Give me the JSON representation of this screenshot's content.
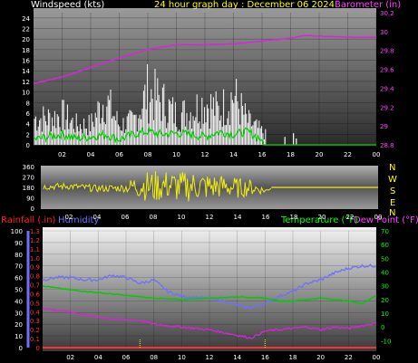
{
  "colors": {
    "wind": "#ffffff",
    "gust": "#ffffff",
    "wind_avg": "#00d000",
    "barometer": "#e020e0",
    "direction": "#f2ef10",
    "rainfall_label": "#ff2020",
    "rainfall_axis": "#ff3030",
    "humidity": "#6f6fff",
    "temperature": "#00cc00",
    "dewpoint": "#dd20dd",
    "text_white": "#ffffff",
    "date_header": "#ffff00",
    "baro_axis": "#ff40ff",
    "temp_axis": "#00ff00",
    "dir_axis": "#ffff00"
  },
  "header": {
    "wind_label": "Windspeed (kts)",
    "date_label": "24 hour graph day : December 06 2024",
    "baro_label": "Barometer (in)"
  },
  "middle": {
    "compass_letters": [
      "N",
      "W",
      "S",
      "E",
      "N"
    ]
  },
  "bottom_header": {
    "rain_label": "Rainfall (.in)",
    "humidity_label": "Humidity",
    "temp_label": "Temperature (°F)",
    "dew_label": "Dew Point (°F)"
  },
  "chart_data": [
    {
      "type": "line",
      "title": "24 hour graph day : December 06 2024",
      "x_ticks": [
        "02",
        "04",
        "06",
        "08",
        "10",
        "12",
        "14",
        "16",
        "18",
        "20",
        "22",
        "00"
      ],
      "xlim": [
        0,
        24
      ],
      "left_axis": {
        "label": "Windspeed (kts)",
        "ylim": [
          0,
          25
        ],
        "ticks": [
          "0",
          "2",
          "4",
          "6",
          "8",
          "10",
          "12",
          "14",
          "16",
          "18",
          "20",
          "22",
          "24"
        ]
      },
      "right_axis": {
        "label": "Barometer (in)",
        "ylim": [
          28.8,
          30.2
        ],
        "ticks": [
          "28.8",
          "29",
          "29.2",
          "29.4",
          "29.6",
          "29.8",
          "30",
          "30.2"
        ]
      },
      "series": [
        {
          "name": "Barometer (in)",
          "axis": "right",
          "x": [
            0,
            2,
            4,
            6,
            8,
            10,
            12,
            14,
            16,
            18,
            19,
            20,
            22,
            24
          ],
          "y": [
            29.45,
            29.52,
            29.62,
            29.72,
            29.81,
            29.86,
            29.86,
            29.87,
            29.9,
            29.93,
            29.96,
            29.95,
            29.94,
            29.94
          ]
        },
        {
          "name": "Wind average (kts)",
          "axis": "left",
          "x": [
            0,
            1,
            2,
            3,
            4,
            5,
            6,
            7,
            8,
            9,
            10,
            11,
            12,
            13,
            14,
            15,
            16,
            16.1,
            24
          ],
          "y": [
            1.0,
            1.5,
            2.0,
            1.2,
            1.5,
            2.0,
            1.0,
            2.0,
            2.5,
            2.0,
            2.2,
            2.0,
            1.5,
            2.5,
            2.0,
            2.5,
            1.0,
            0,
            0
          ]
        },
        {
          "name": "Wind gust (kts)",
          "axis": "left",
          "x": [
            0,
            1,
            2,
            3,
            4,
            5,
            6,
            7,
            8,
            9,
            10,
            11,
            12,
            13,
            14,
            15,
            16,
            17,
            18,
            19,
            20,
            21,
            22,
            23,
            24
          ],
          "y": [
            8,
            8,
            9,
            6,
            6,
            14,
            6,
            7,
            16,
            13,
            9,
            10,
            13,
            10,
            15,
            7,
            4,
            0,
            2,
            0,
            0,
            0,
            0,
            0,
            0
          ]
        }
      ]
    },
    {
      "type": "line",
      "x_ticks": [
        "02",
        "04",
        "06",
        "08",
        "10",
        "12",
        "14",
        "16",
        "18",
        "20",
        "22",
        "00"
      ],
      "xlim": [
        0,
        24
      ],
      "left_axis": {
        "ylim": [
          0,
          360
        ],
        "ticks": [
          "0",
          "90",
          "180",
          "270",
          "360"
        ]
      },
      "series": [
        {
          "name": "Wind direction (deg)",
          "x": [
            0,
            2,
            4,
            6,
            7,
            8,
            9,
            10,
            11,
            12,
            13,
            14,
            15,
            16,
            16.5,
            24
          ],
          "y": [
            185,
            190,
            170,
            175,
            200,
            185,
            200,
            180,
            195,
            185,
            190,
            175,
            180,
            150,
            180,
            180
          ],
          "band": [
            25,
            30,
            30,
            35,
            120,
            140,
            130,
            140,
            130,
            120,
            100,
            90,
            70,
            20,
            0,
            0
          ]
        }
      ]
    },
    {
      "type": "line",
      "x_ticks": [
        "02",
        "04",
        "06",
        "08",
        "10",
        "12",
        "14",
        "16",
        "18",
        "20",
        "22",
        "00"
      ],
      "xlim": [
        0,
        24
      ],
      "left_axis_humidity": {
        "label": "Humidity",
        "ylim": [
          0,
          100
        ],
        "ticks": [
          "0",
          "10",
          "20",
          "30",
          "40",
          "50",
          "60",
          "70",
          "80",
          "90",
          "100"
        ]
      },
      "left_axis_rain": {
        "label": "Rainfall (.in)",
        "ylim": [
          0,
          1.3
        ],
        "ticks": [
          "0",
          "0.1",
          "0.2",
          "0.3",
          "0.4",
          "0.5",
          "0.6",
          "0.7",
          "0.8",
          "0.9",
          "1.0",
          "1.1",
          "1.2",
          "1.3"
        ]
      },
      "right_axis": {
        "label": "Temperature (°F)",
        "ylim": [
          -15,
          70
        ],
        "ticks": [
          "-10",
          "0",
          "10",
          "20",
          "30",
          "40",
          "50",
          "60",
          "70"
        ]
      },
      "series": [
        {
          "name": "Humidity",
          "axis": "humidity",
          "x": [
            0,
            1,
            2,
            3,
            4,
            5,
            6,
            7,
            8,
            9,
            10,
            11,
            12,
            13,
            14,
            15,
            16,
            17,
            18,
            19,
            20,
            21,
            22,
            23,
            24
          ],
          "y": [
            58,
            60,
            60,
            58,
            58,
            62,
            60,
            55,
            58,
            48,
            44,
            43,
            42,
            40,
            36,
            34,
            38,
            44,
            48,
            55,
            58,
            64,
            68,
            70,
            70
          ]
        },
        {
          "name": "Temperature (°F)",
          "axis": "temp",
          "x": [
            0,
            2,
            4,
            6,
            8,
            10,
            12,
            14,
            16,
            17,
            18,
            19,
            20,
            21,
            22,
            23,
            24
          ],
          "y": [
            30,
            27,
            25,
            23,
            21,
            20,
            21,
            22,
            21,
            19,
            19,
            20,
            21,
            20,
            19,
            17,
            23
          ]
        },
        {
          "name": "Dew Point (°F)",
          "axis": "temp",
          "x": [
            0,
            1,
            2,
            3,
            4,
            5,
            6,
            7,
            8,
            9,
            10,
            11,
            12,
            13,
            14,
            15,
            16,
            17,
            18,
            19,
            20,
            21,
            22,
            23,
            24
          ],
          "y": [
            14,
            12,
            11,
            9,
            7,
            6,
            5,
            5,
            2,
            1,
            0,
            -1,
            -2,
            -4,
            -6,
            -8,
            -3,
            -2,
            -1,
            0,
            -2,
            0,
            -1,
            1,
            3
          ]
        },
        {
          "name": "Rainfall (.in)",
          "axis": "rain",
          "x": [
            0,
            24
          ],
          "y": [
            0,
            0
          ]
        }
      ],
      "markers_x": [
        7,
        16
      ]
    }
  ]
}
